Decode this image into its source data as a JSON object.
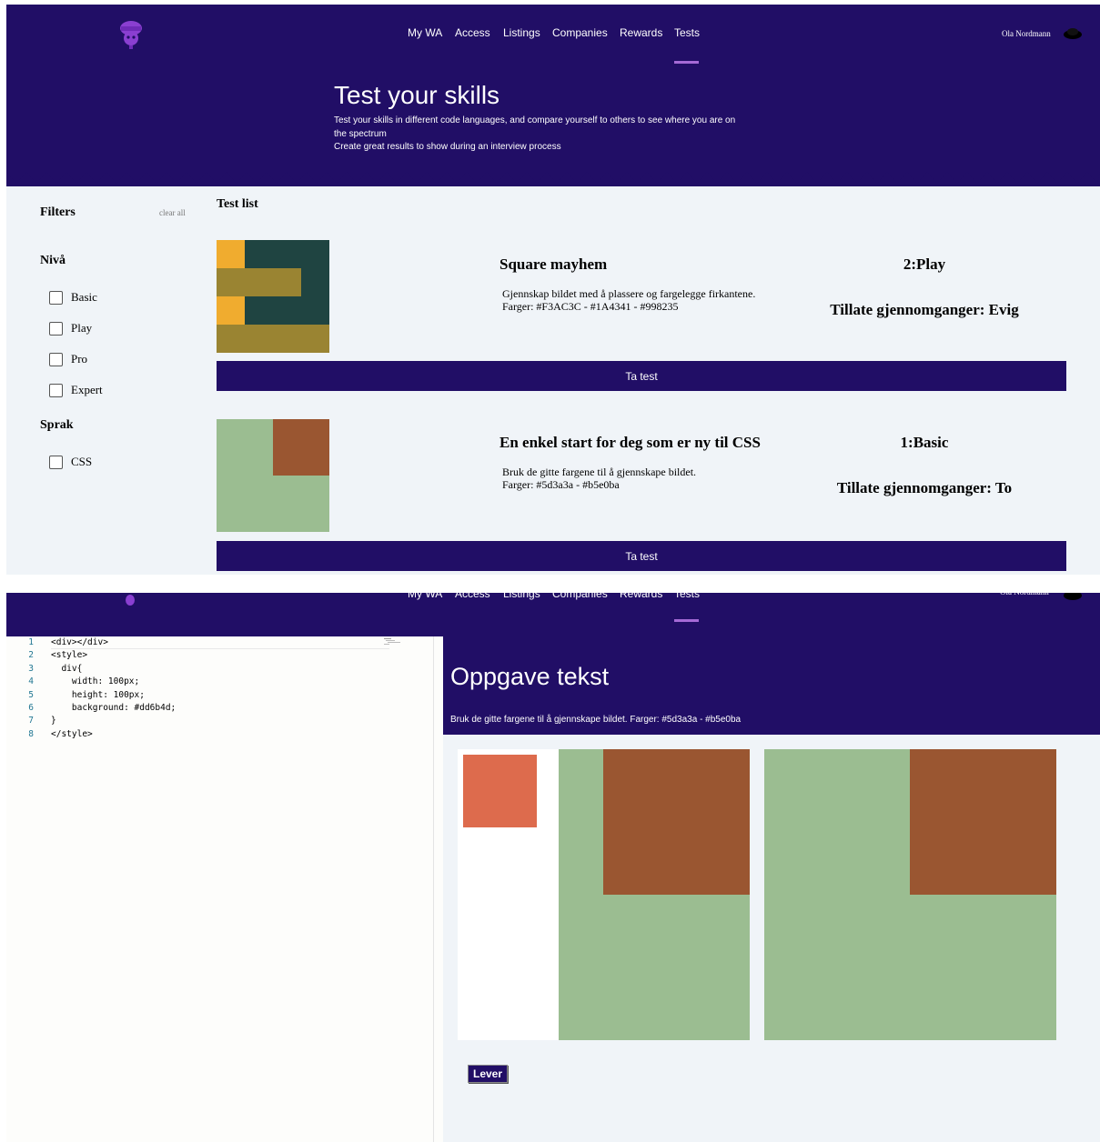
{
  "nav": {
    "items": [
      "My WA",
      "Access",
      "Listings",
      "Companies",
      "Rewards",
      "Tests"
    ],
    "active": "Tests",
    "user_name": "Ola Nordmann"
  },
  "hero": {
    "title": "Test your skills",
    "line1": "Test your skills in different code languages, and compare yourself to others to see where you are on",
    "line2": "the spectrum",
    "line3": "Create great results to show during an interview process"
  },
  "filters": {
    "title": "Filters",
    "clear_all": "clear all",
    "niva_title": "Nivå",
    "niva_options": [
      "Basic",
      "Play",
      "Pro",
      "Expert"
    ],
    "sprak_title": "Sprak",
    "sprak_options": [
      "CSS"
    ]
  },
  "test_list": {
    "title": "Test list",
    "tests": [
      {
        "title": "Square mayhem",
        "desc_line1": "Gjennskap bildet med å plassere og fargelegge firkantene.",
        "desc_line2": "Farger: #F3AC3C - #1A4341 - #998235",
        "level": "2:Play",
        "attempts": "Tillate gjennomganger: Evig",
        "button": "Ta test",
        "colors": [
          "#f0ac2f",
          "#1f4441",
          "#9a8432"
        ]
      },
      {
        "title": "En enkel start for deg som er ny til CSS",
        "desc_line1": "Bruk de gitte fargene til å gjennskape bildet.",
        "desc_line2": "Farger: #5d3a3a - #b5e0ba",
        "level": "1:Basic",
        "attempts": "Tillate gjennomganger: To",
        "button": "Ta test",
        "colors": [
          "#9bbd91",
          "#9a5631"
        ]
      }
    ]
  },
  "editor": {
    "lines": [
      {
        "n": "1",
        "text": "<div></div>"
      },
      {
        "n": "2",
        "text": "<style>"
      },
      {
        "n": "3",
        "text": "  div{"
      },
      {
        "n": "4",
        "text": "    width: 100px;"
      },
      {
        "n": "5",
        "text": "    height: 100px;"
      },
      {
        "n": "6",
        "text": "    background: #dd6b4d;"
      },
      {
        "n": "7",
        "text": "}"
      },
      {
        "n": "8",
        "text": "</style>"
      }
    ]
  },
  "task": {
    "title": "Oppgave tekst",
    "description": "Bruk de gitte fargene til å gjennskape bildet. Farger: #5d3a3a - #b5e0ba",
    "submit": "Lever",
    "user_color": "#dd6b4d",
    "target_colors": [
      "#9bbd91",
      "#9a5631"
    ]
  },
  "colors": {
    "brand": "#210e66",
    "accent": "#a56ad6",
    "page_bg": "#f0f4f8"
  }
}
